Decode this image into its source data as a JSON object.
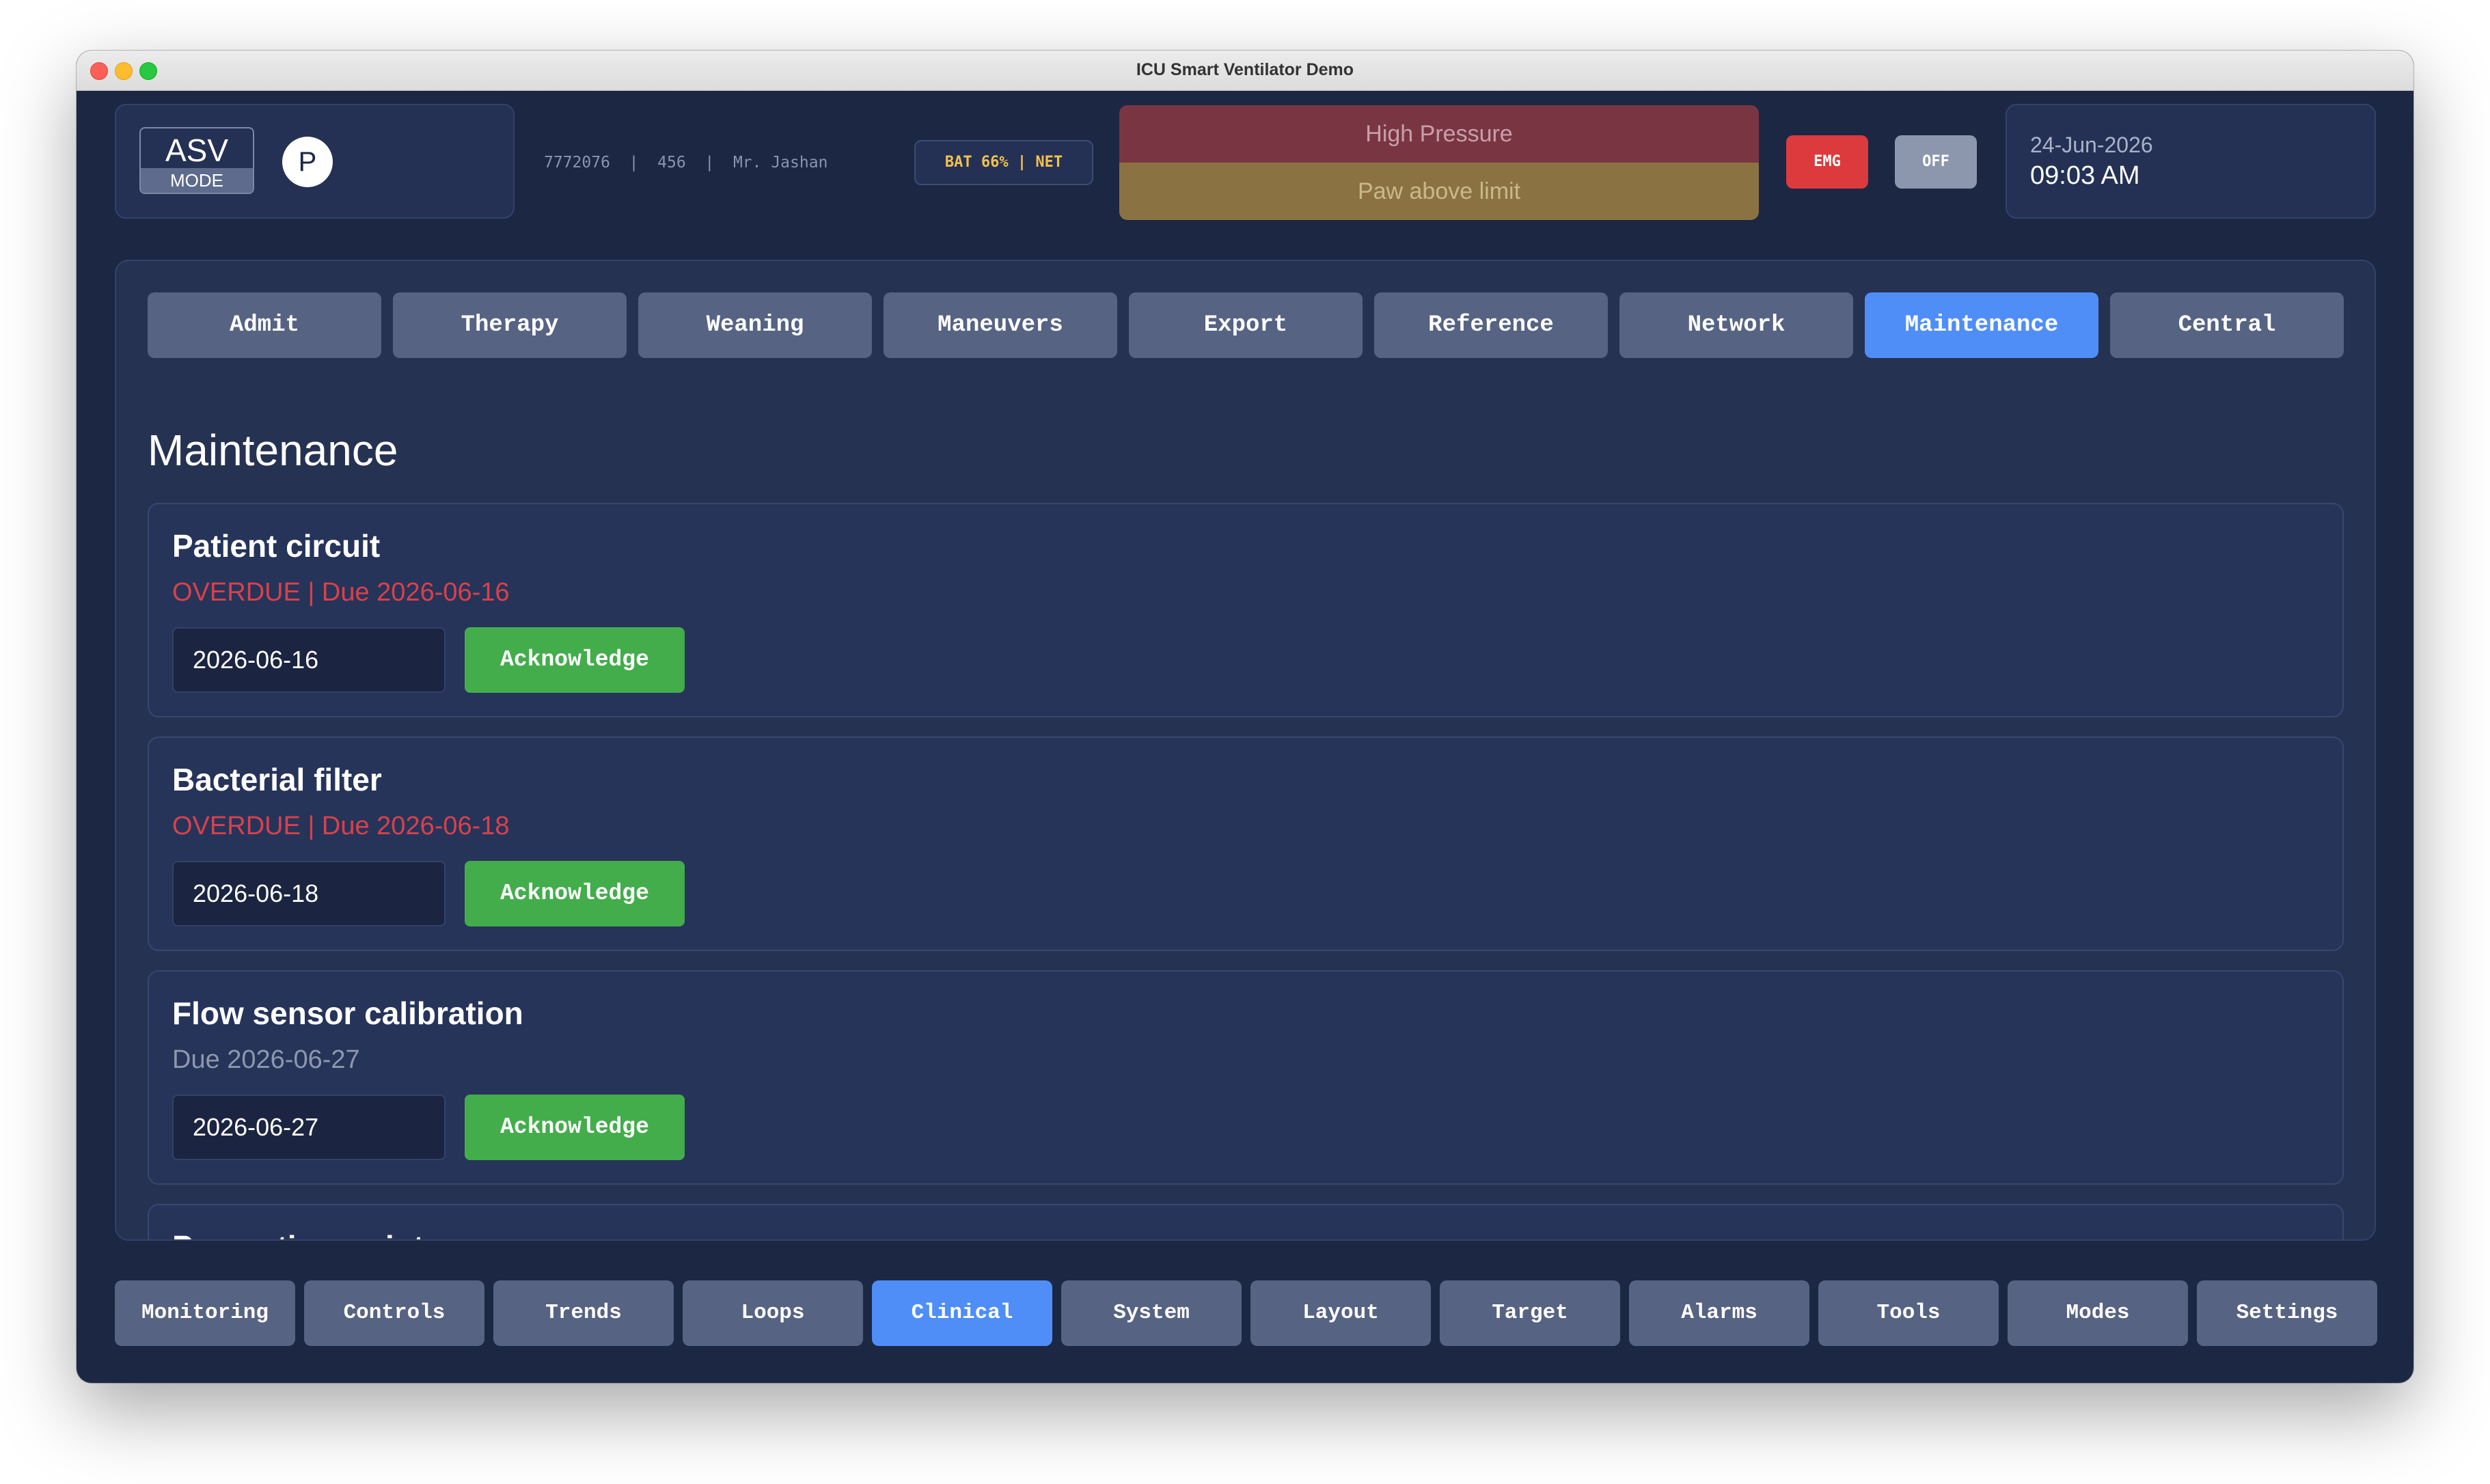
{
  "window": {
    "title": "ICU Smart Ventilator Demo"
  },
  "header": {
    "mode": {
      "name": "ASV",
      "label": "MODE",
      "type_letter": "P"
    },
    "patient_info": "7772076  |  456  |  Mr. Jashan",
    "status_badge": "BAT 66% | NET",
    "alarms": {
      "primary": "High Pressure",
      "secondary": "Paw above limit"
    },
    "emg_label": "EMG",
    "off_label": "OFF",
    "date": "24-Jun-2026",
    "time": "09:03 AM"
  },
  "tabs": [
    {
      "label": "Admit"
    },
    {
      "label": "Therapy"
    },
    {
      "label": "Weaning"
    },
    {
      "label": "Maneuvers"
    },
    {
      "label": "Export"
    },
    {
      "label": "Reference"
    },
    {
      "label": "Network"
    },
    {
      "label": "Maintenance"
    },
    {
      "label": "Central"
    }
  ],
  "active_tab": "Maintenance",
  "section_title": "Maintenance",
  "maintenance_items": [
    {
      "title": "Patient circuit",
      "status": "OVERDUE | Due 2026-06-16",
      "date_value": "2026-06-16",
      "button": "Acknowledge"
    },
    {
      "title": "Bacterial filter",
      "status": "OVERDUE | Due 2026-06-18",
      "date_value": "2026-06-18",
      "button": "Acknowledge"
    },
    {
      "title": "Flow sensor calibration",
      "status": "Due 2026-06-27",
      "date_value": "2026-06-27",
      "button": "Acknowledge"
    },
    {
      "title": "Preventive maintenance"
    }
  ],
  "bottom_nav": [
    {
      "label": "Monitoring"
    },
    {
      "label": "Controls"
    },
    {
      "label": "Trends"
    },
    {
      "label": "Loops"
    },
    {
      "label": "Clinical"
    },
    {
      "label": "System"
    },
    {
      "label": "Layout"
    },
    {
      "label": "Target"
    },
    {
      "label": "Alarms"
    },
    {
      "label": "Tools"
    },
    {
      "label": "Modes"
    },
    {
      "label": "Settings"
    }
  ],
  "active_nav": "Clinical"
}
